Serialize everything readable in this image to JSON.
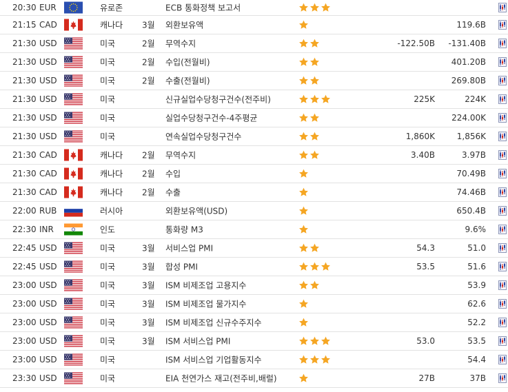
{
  "colors": {
    "star": "#f5a623",
    "row_border": "#e2e2e2",
    "text": "#333333"
  },
  "icons": {
    "importance": "star-icon",
    "chart": "chart-icon"
  },
  "rows": [
    {
      "time": "20:30",
      "currency": "EUR",
      "flag": "eu",
      "country": "유로존",
      "month": "",
      "event": "ECB 통화정책 보고서",
      "stars": 3,
      "forecast": "",
      "previous": ""
    },
    {
      "time": "21:15",
      "currency": "CAD",
      "flag": "ca",
      "country": "캐나다",
      "month": "3월",
      "event": "외환보유액",
      "stars": 1,
      "forecast": "",
      "previous": "119.6B"
    },
    {
      "time": "21:30",
      "currency": "USD",
      "flag": "us",
      "country": "미국",
      "month": "2월",
      "event": "무역수지",
      "stars": 2,
      "forecast": "-122.50B",
      "previous": "-131.40B"
    },
    {
      "time": "21:30",
      "currency": "USD",
      "flag": "us",
      "country": "미국",
      "month": "2월",
      "event": "수입(전월비)",
      "stars": 2,
      "forecast": "",
      "previous": "401.20B"
    },
    {
      "time": "21:30",
      "currency": "USD",
      "flag": "us",
      "country": "미국",
      "month": "2월",
      "event": "수출(전월비)",
      "stars": 2,
      "forecast": "",
      "previous": "269.80B"
    },
    {
      "time": "21:30",
      "currency": "USD",
      "flag": "us",
      "country": "미국",
      "month": "",
      "event": "신규실업수당청구건수(전주비)",
      "stars": 3,
      "forecast": "225K",
      "previous": "224K"
    },
    {
      "time": "21:30",
      "currency": "USD",
      "flag": "us",
      "country": "미국",
      "month": "",
      "event": "실업수당청구건수-4주평균",
      "stars": 2,
      "forecast": "",
      "previous": "224.00K"
    },
    {
      "time": "21:30",
      "currency": "USD",
      "flag": "us",
      "country": "미국",
      "month": "",
      "event": "연속실업수당청구건수",
      "stars": 2,
      "forecast": "1,860K",
      "previous": "1,856K"
    },
    {
      "time": "21:30",
      "currency": "CAD",
      "flag": "ca",
      "country": "캐나다",
      "month": "2월",
      "event": "무역수지",
      "stars": 2,
      "forecast": "3.40B",
      "previous": "3.97B"
    },
    {
      "time": "21:30",
      "currency": "CAD",
      "flag": "ca",
      "country": "캐나다",
      "month": "2월",
      "event": "수입",
      "stars": 1,
      "forecast": "",
      "previous": "70.49B"
    },
    {
      "time": "21:30",
      "currency": "CAD",
      "flag": "ca",
      "country": "캐나다",
      "month": "2월",
      "event": "수출",
      "stars": 1,
      "forecast": "",
      "previous": "74.46B"
    },
    {
      "time": "22:00",
      "currency": "RUB",
      "flag": "ru",
      "country": "러시아",
      "month": "",
      "event": "외환보유액(USD)",
      "stars": 1,
      "forecast": "",
      "previous": "650.4B"
    },
    {
      "time": "22:30",
      "currency": "INR",
      "flag": "in",
      "country": "인도",
      "month": "",
      "event": "통화량 M3",
      "stars": 1,
      "forecast": "",
      "previous": "9.6%"
    },
    {
      "time": "22:45",
      "currency": "USD",
      "flag": "us",
      "country": "미국",
      "month": "3월",
      "event": "서비스업 PMI",
      "stars": 2,
      "forecast": "54.3",
      "previous": "51.0"
    },
    {
      "time": "22:45",
      "currency": "USD",
      "flag": "us",
      "country": "미국",
      "month": "3월",
      "event": "합성 PMI",
      "stars": 3,
      "forecast": "53.5",
      "previous": "51.6"
    },
    {
      "time": "23:00",
      "currency": "USD",
      "flag": "us",
      "country": "미국",
      "month": "3월",
      "event": "ISM 비제조업 고용지수",
      "stars": 2,
      "forecast": "",
      "previous": "53.9"
    },
    {
      "time": "23:00",
      "currency": "USD",
      "flag": "us",
      "country": "미국",
      "month": "3월",
      "event": "ISM 비제조업 물가지수",
      "stars": 1,
      "forecast": "",
      "previous": "62.6"
    },
    {
      "time": "23:00",
      "currency": "USD",
      "flag": "us",
      "country": "미국",
      "month": "3월",
      "event": "ISM 비제조업 신규수주지수",
      "stars": 1,
      "forecast": "",
      "previous": "52.2"
    },
    {
      "time": "23:00",
      "currency": "USD",
      "flag": "us",
      "country": "미국",
      "month": "3월",
      "event": "ISM 서비스업 PMI",
      "stars": 3,
      "forecast": "53.0",
      "previous": "53.5"
    },
    {
      "time": "23:00",
      "currency": "USD",
      "flag": "us",
      "country": "미국",
      "month": "",
      "event": "ISM 서비스업 기업활동지수",
      "stars": 3,
      "forecast": "",
      "previous": "54.4"
    },
    {
      "time": "23:30",
      "currency": "USD",
      "flag": "us",
      "country": "미국",
      "month": "",
      "event": "EIA 천연가스 재고(전주비,배럴)",
      "stars": 1,
      "forecast": "27B",
      "previous": "37B"
    }
  ]
}
